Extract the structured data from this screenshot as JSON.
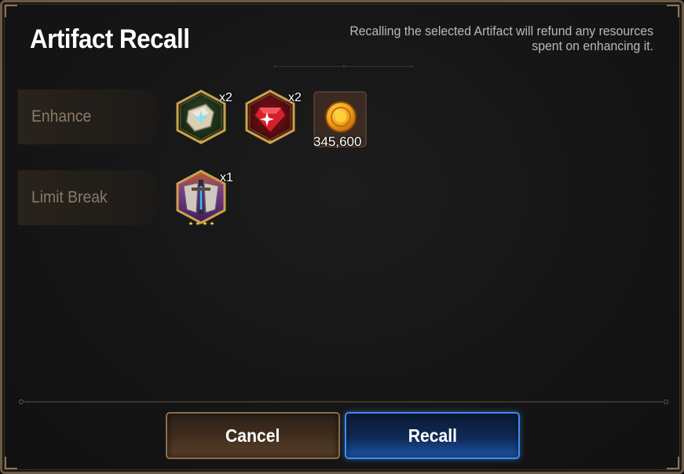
{
  "dialog": {
    "title": "Artifact Recall",
    "subtitle_line1": "Recalling the selected Artifact will refund any resources",
    "subtitle_line2": "spent on enhancing it."
  },
  "rows": [
    {
      "label": "Enhance",
      "items": [
        {
          "icon": "white-crystal-icon",
          "quantity": "x2"
        },
        {
          "icon": "red-crystal-icon",
          "quantity": "x2"
        },
        {
          "icon": "gold-coin-icon",
          "amount": "345,600"
        }
      ]
    },
    {
      "label": "Limit Break",
      "items": [
        {
          "icon": "artifact-sword-icon",
          "quantity": "x1",
          "stars": 4
        }
      ]
    }
  ],
  "buttons": {
    "cancel": "Cancel",
    "recall": "Recall"
  },
  "colors": {
    "frame": "#6b5a45",
    "label_text": "#8a7a68",
    "recall_accent": "#3d8cf0",
    "cancel_accent": "#8a6d4d"
  }
}
